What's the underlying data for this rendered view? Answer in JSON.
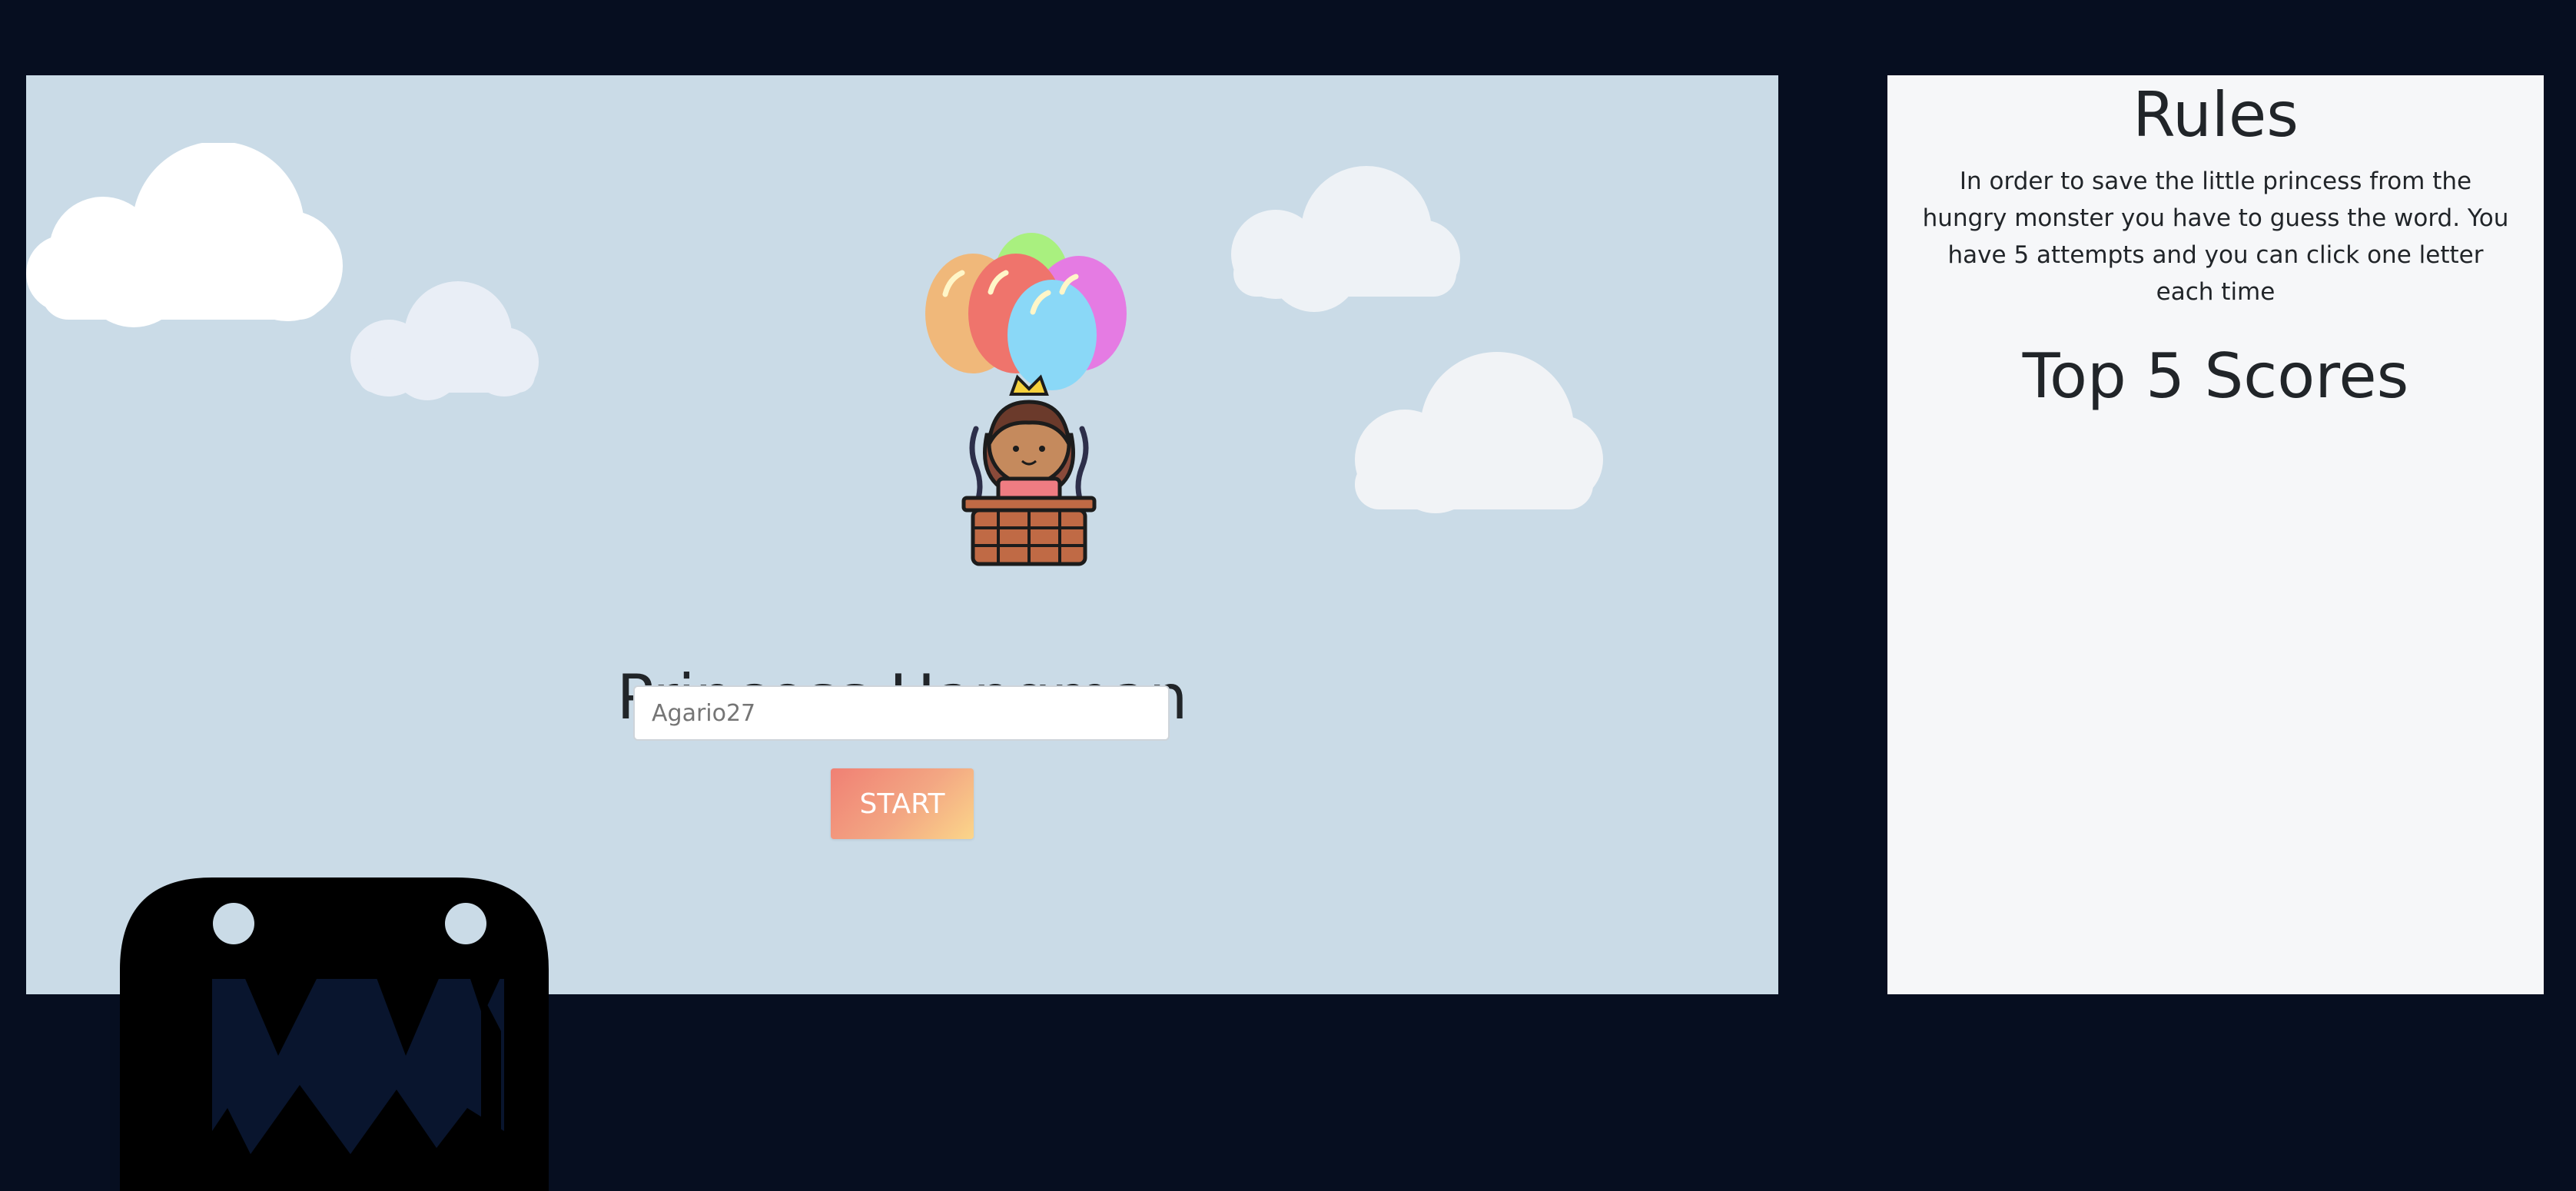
{
  "game": {
    "title": "Princess Hangman",
    "name_input": {
      "value": "",
      "placeholder": "Agario27"
    },
    "start_label": "START",
    "colors": {
      "sky": "#cadbe7",
      "background": "#060e20",
      "start_gradient": [
        "#f08074",
        "#fbd68a"
      ]
    },
    "icons": {
      "princess": "princess-balloon-icon",
      "monster": "monster-icon",
      "cloud": "cloud-icon"
    }
  },
  "rules": {
    "title": "Rules",
    "text": "In order to save the little princess from the hungry monster you have to guess the word. You have 5 attempts and you can click one letter each time",
    "scores_title": "Top 5 Scores",
    "scores": []
  }
}
